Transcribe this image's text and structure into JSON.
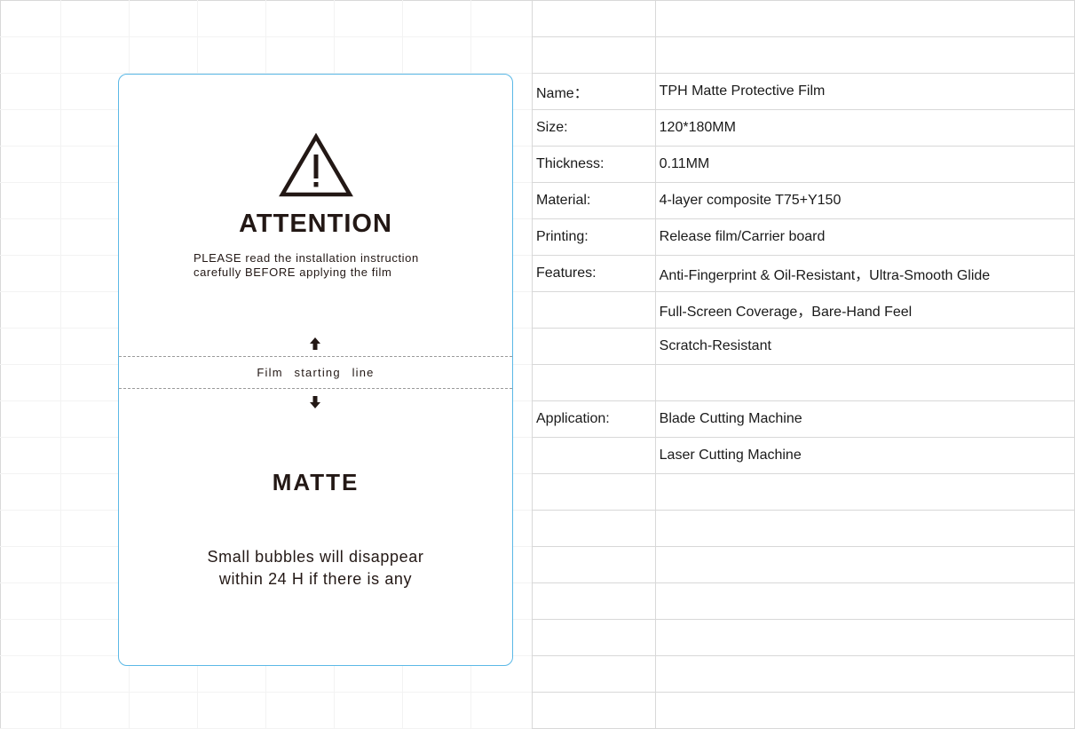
{
  "label": {
    "title": "ATTENTION",
    "instruction_line1": "PLEASE read the installation instruction",
    "instruction_line2": "carefully BEFORE applying the film",
    "film_line_text": "Film  starting line",
    "finish": "MATTE",
    "bubbles_line1": "Small bubbles will disappear",
    "bubbles_line2": "within 24 H if there is any",
    "border_color": "#5bb8e6",
    "icons": [
      "warning-triangle-icon",
      "arrow-up-icon",
      "arrow-down-icon"
    ]
  },
  "spec_table": {
    "rows": [
      {
        "label": "",
        "value": ""
      },
      {
        "label": "",
        "value": ""
      },
      {
        "label": "Name：",
        "value": "TPH Matte Protective Film"
      },
      {
        "label": "Size:",
        "value": "120*180MM"
      },
      {
        "label": "Thickness:",
        "value": "0.11MM"
      },
      {
        "label": "Material:",
        "value": "4-layer composite T75+Y150"
      },
      {
        "label": "Printing:",
        "value": "Release film/Carrier board"
      },
      {
        "label": "Features:",
        "value": "Anti-Fingerprint & Oil-Resistant，Ultra-Smooth Glide"
      },
      {
        "label": "",
        "value": "Full-Screen Coverage，Bare-Hand Feel"
      },
      {
        "label": "",
        "value": "Scratch-Resistant"
      },
      {
        "label": "",
        "value": ""
      },
      {
        "label": "Application:",
        "value": "Blade Cutting Machine"
      },
      {
        "label": "",
        "value": "Laser Cutting Machine"
      },
      {
        "label": "",
        "value": ""
      },
      {
        "label": "",
        "value": ""
      },
      {
        "label": "",
        "value": ""
      },
      {
        "label": "",
        "value": ""
      },
      {
        "label": "",
        "value": ""
      },
      {
        "label": "",
        "value": ""
      },
      {
        "label": "",
        "value": ""
      }
    ]
  }
}
